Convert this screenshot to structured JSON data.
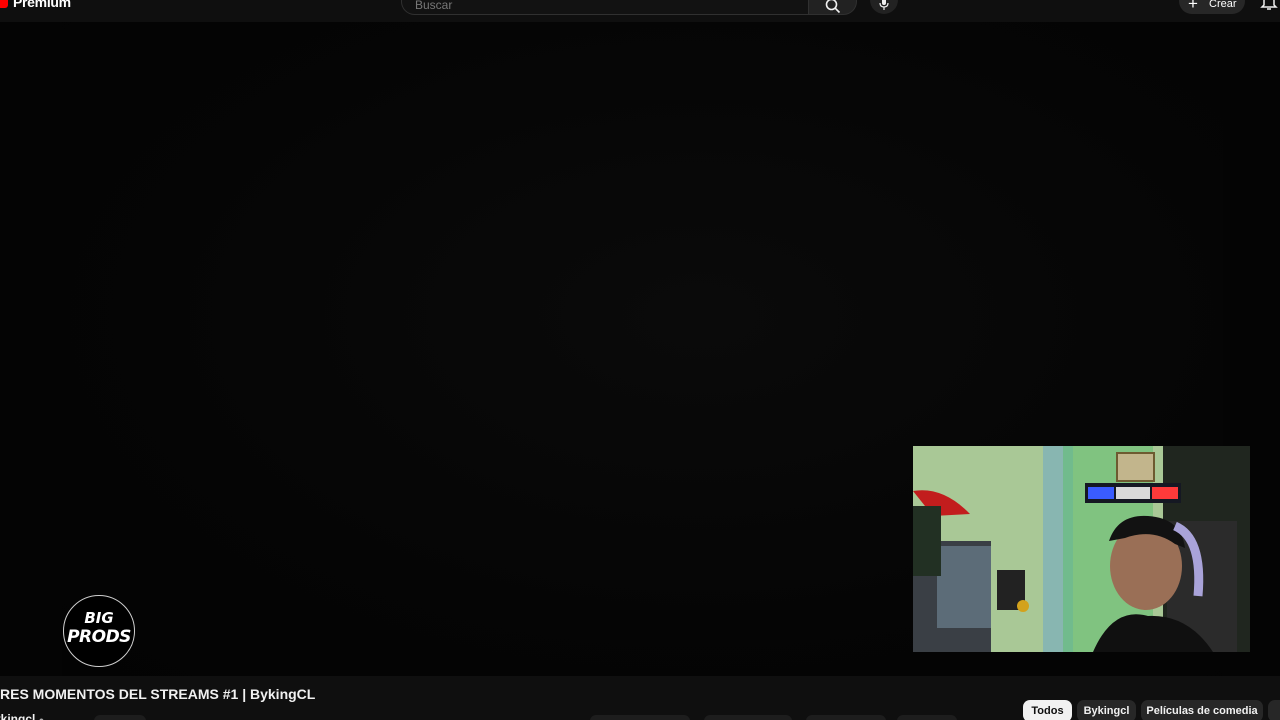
{
  "header": {
    "logo_text": "Premium",
    "search_placeholder": "Buscar",
    "create_label": "Crear"
  },
  "player": {
    "watermark_line1": "BIG",
    "watermark_line2": "PRODS"
  },
  "video": {
    "title": "RES MOMENTOS DEL STREAMS #1 | BykingCL",
    "channel": "ykingcl"
  },
  "chips": [
    {
      "label": "Todos",
      "active": true
    },
    {
      "label": "Bykingcl",
      "active": false
    },
    {
      "label": "Películas de comedia",
      "active": false
    }
  ],
  "colors": {
    "brand_red": "#ff0000",
    "background": "#0f0f0f",
    "chip_bg": "#272727",
    "chip_active_bg": "#f1f1f1"
  },
  "icons": [
    "youtube-logo-icon",
    "search-icon",
    "mic-icon",
    "plus-icon",
    "bell-icon",
    "verified-icon"
  ]
}
